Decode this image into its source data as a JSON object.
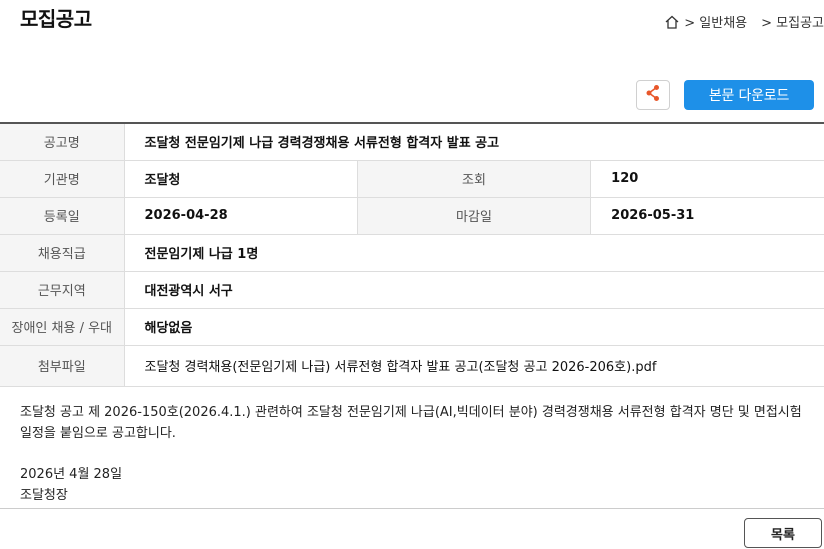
{
  "header": {
    "title": "모집공고",
    "breadcrumb": [
      "> 일반채용",
      "> 모집공고"
    ]
  },
  "toolbar": {
    "download_label": "본문 다운로드"
  },
  "info": {
    "notice_name_label": "공고명",
    "notice_name": "조달청 전문임기제 나급 경력경쟁채용 서류전형 합격자 발표 공고",
    "agency_label": "기관명",
    "agency": "조달청",
    "views_label": "조회",
    "views": "120",
    "registered_label": "등록일",
    "registered": "2026-04-28",
    "deadline_label": "마감일",
    "deadline": "2026-05-31",
    "position_label": "채용직급",
    "position": "전문임기제 나급 1명",
    "location_label": "근무지역",
    "location": "대전광역시 서구",
    "disability_label": "장애인 채용 / 우대",
    "disability": "해당없음",
    "attachment_label": "첨부파일",
    "attachment": "조달청 경력채용(전문임기제 나급) 서류전형 합격자 발표 공고(조달청 공고 2026-206호).pdf"
  },
  "content": {
    "paragraph": "조달청 공고 제 2026-150호(2026.4.1.) 관련하여 조달청 전문임기제 나급(AI,빅데이터 분야) 경력경쟁채용 서류전형 합격자 명단 및 면접시험 일정을 붙임으로 공고합니다.",
    "date": "2026년 4월 28일",
    "signature": "조달청장"
  },
  "footer": {
    "list_label": "목록"
  },
  "colors": {
    "accent": "#1e90e8",
    "share_icon": "#e8572a"
  },
  "icons": {
    "home": "home-icon",
    "share": "share-icon"
  }
}
